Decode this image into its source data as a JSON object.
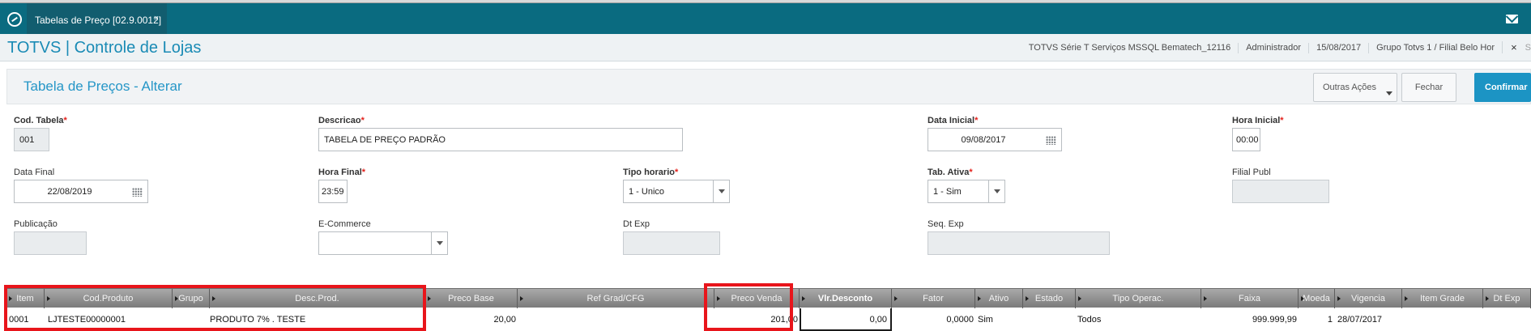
{
  "browser": {
    "tab_title": "Tabelas de Preço [02.9.0012]",
    "tab_close": "×"
  },
  "header": {
    "app_title": "TOTVS | Controle de Lojas",
    "environment": "TOTVS Série T Serviços MSSQL Bematech_12116",
    "user": "Administrador",
    "date": "15/08/2017",
    "branch": "Grupo Totvs 1 / Filial Belo Hor",
    "close": "×",
    "extra": "S"
  },
  "page": {
    "title": "Tabela de Preços - Alterar",
    "buttons": {
      "other_actions": "Outras Ações",
      "close": "Fechar",
      "confirm": "Confirmar"
    }
  },
  "form": {
    "cod_tabela": {
      "label": "Cod. Tabela",
      "required": "*",
      "value": "001"
    },
    "descricao": {
      "label": "Descricao",
      "required": "*",
      "value": "TABELA DE PREÇO PADRÃO"
    },
    "data_inicial": {
      "label": "Data Inicial",
      "required": "*",
      "value": "09/08/2017"
    },
    "hora_inicial": {
      "label": "Hora Inicial",
      "required": "*",
      "value": "00:00"
    },
    "data_final": {
      "label": "Data Final",
      "value": "22/08/2019"
    },
    "hora_final": {
      "label": "Hora Final",
      "required": "*",
      "value": "23:59"
    },
    "tipo_horario": {
      "label": "Tipo horario",
      "required": "*",
      "value": "1 - Unico"
    },
    "tab_ativa": {
      "label": "Tab. Ativa",
      "required": "*",
      "value": "1 - Sim"
    },
    "filial_publ": {
      "label": "Filial Publ",
      "value": ""
    },
    "publicacao": {
      "label": "Publicação",
      "value": ""
    },
    "ecommerce": {
      "label": "E-Commerce",
      "value": ""
    },
    "dt_exp": {
      "label": "Dt Exp",
      "value": ""
    },
    "seq_exp": {
      "label": "Seq. Exp",
      "value": ""
    }
  },
  "grid": {
    "columns": [
      "Item",
      "Cod.Produto",
      "Grupo",
      "Desc.Prod.",
      "Preco Base",
      "Ref Grad/CFG",
      "Preco Venda",
      "Vlr.Desconto",
      "Fator",
      "Ativo",
      "Estado",
      "Tipo Operac.",
      "Faixa",
      "Moeda",
      "Vigencia",
      "Item Grade",
      "Dt Exp"
    ],
    "rows": [
      {
        "item": "0001",
        "cod_produto": "LJTESTE00000001",
        "grupo": "",
        "desc_prod": "PRODUTO 7% . TESTE",
        "preco_base": "20,00",
        "ref_grad": "",
        "preco_venda": "201,00",
        "vlr_desconto": "0,00",
        "fator": "0,0000",
        "ativo": "Sim",
        "estado": "",
        "tipo_operac": "Todos",
        "faixa": "999.999,99",
        "moeda": "1",
        "vigencia": "28/07/2017",
        "item_grade": "",
        "dt_exp": ""
      }
    ]
  },
  "colors": {
    "brand_bar": "#0a6b80",
    "accent": "#1c94c4",
    "title": "#1a8bb5",
    "required": "#e3211b",
    "highlight": "#e8151b"
  },
  "icons": [
    "app-logo-icon",
    "close-icon",
    "mail-icon",
    "calendar-icon",
    "chevron-down-icon",
    "column-sort-icon"
  ]
}
